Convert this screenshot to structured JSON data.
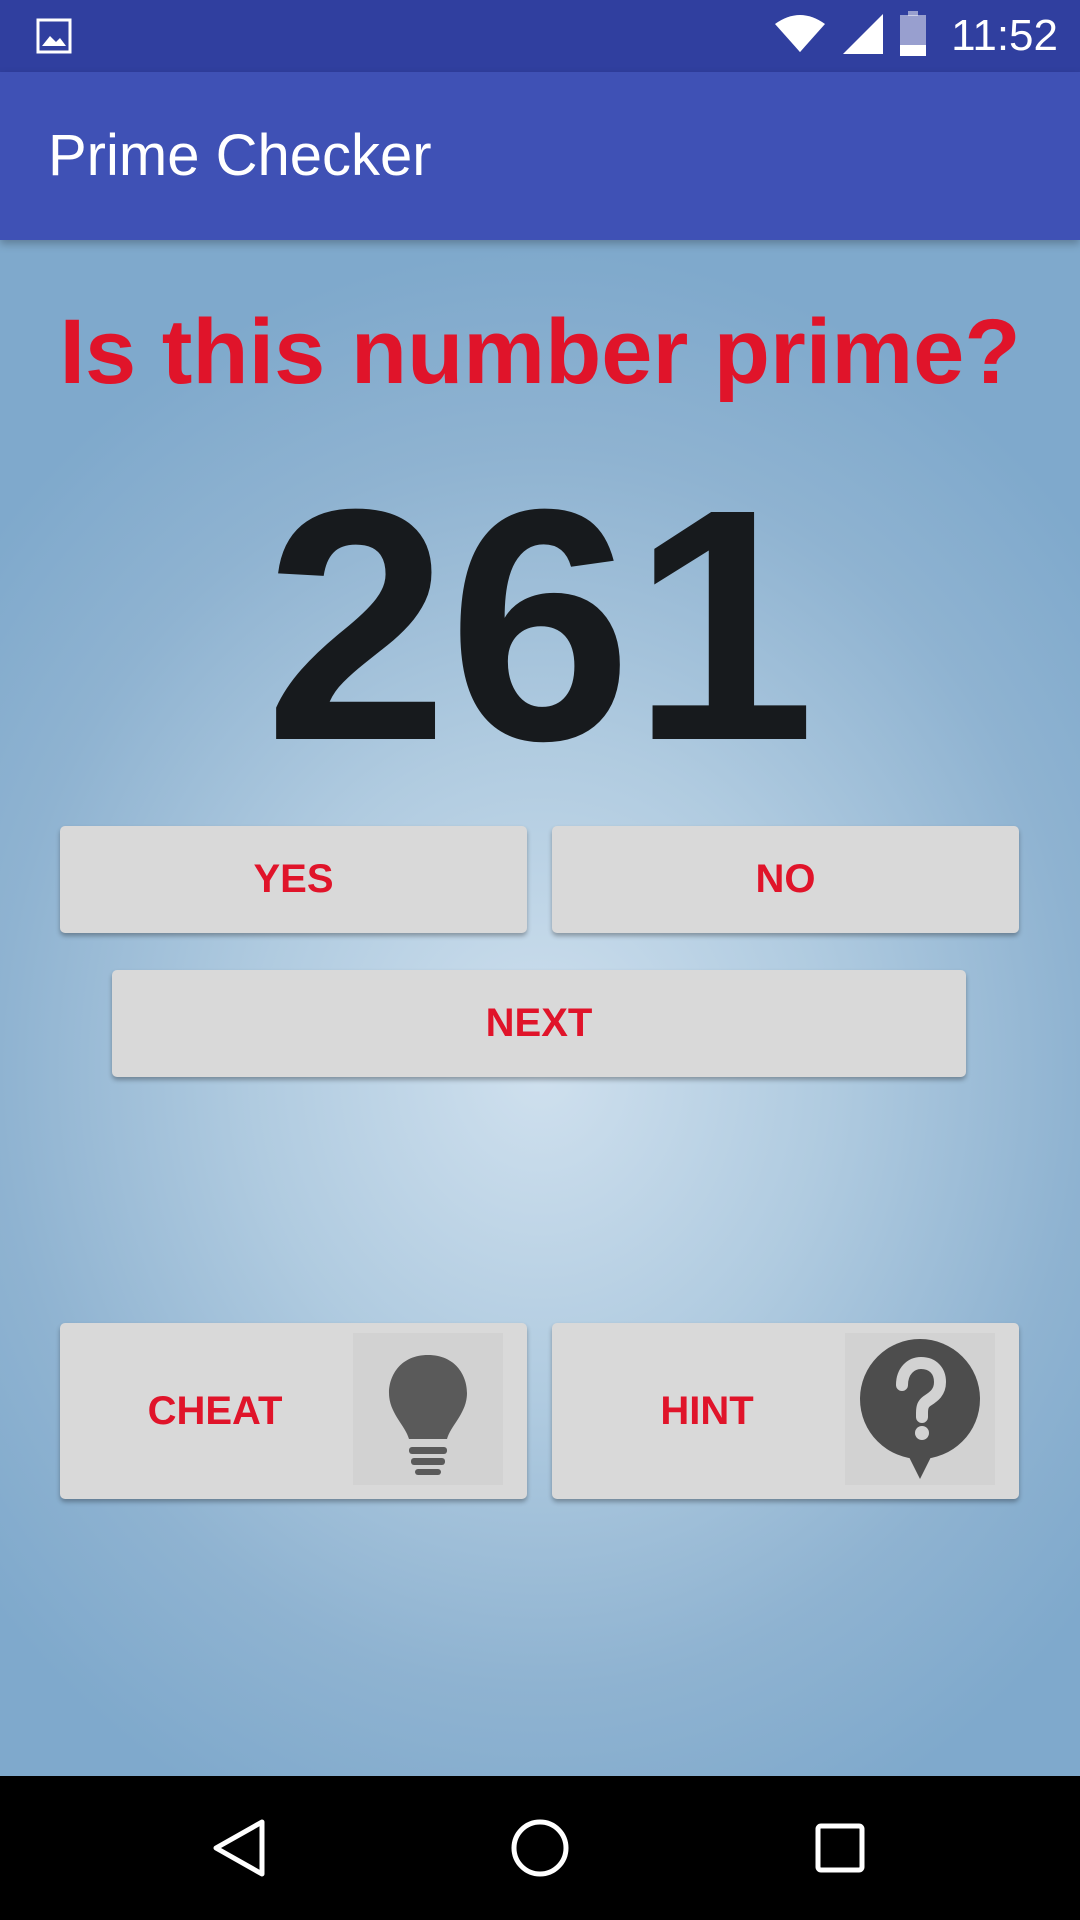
{
  "status_bar": {
    "time": "11:52",
    "icons": [
      "image-notification-icon",
      "wifi-icon",
      "signal-icon",
      "battery-icon"
    ]
  },
  "app_bar": {
    "title": "Prime Checker"
  },
  "main": {
    "question": "Is this number prime?",
    "number": "261",
    "buttons": {
      "yes": "YES",
      "no": "NO",
      "next": "NEXT",
      "cheat": "CHEAT",
      "hint": "HINT"
    }
  },
  "colors": {
    "status_bar": "#303F9F",
    "app_bar": "#3F51B5",
    "accent_text": "#E0142A",
    "number_text": "#171A1D",
    "button_bg": "#D9D9D9"
  },
  "nav_bar": {
    "icons": [
      "back-icon",
      "home-icon",
      "recents-icon"
    ]
  }
}
